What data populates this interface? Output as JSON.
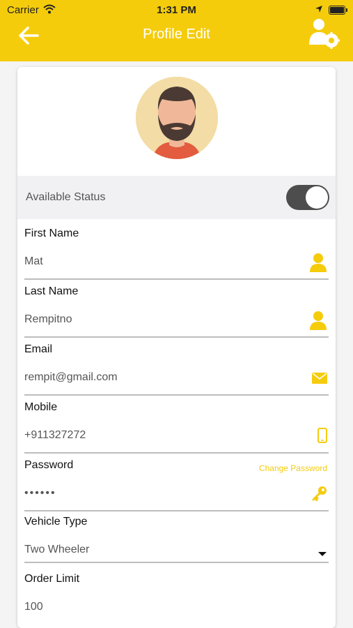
{
  "status_bar": {
    "carrier": "Carrier",
    "time": "1:31 PM"
  },
  "header": {
    "title": "Profile Edit"
  },
  "availability": {
    "label": "Available Status",
    "enabled": true
  },
  "fields": {
    "first_name": {
      "label": "First Name",
      "value": "Mat"
    },
    "last_name": {
      "label": "Last Name",
      "value": "Rempitno"
    },
    "email": {
      "label": "Email",
      "value": "rempit@gmail.com"
    },
    "mobile": {
      "label": "Mobile",
      "value": "+911327272"
    },
    "password": {
      "label": "Password",
      "value": "••••••",
      "change_link": "Change Password"
    },
    "vehicle_type": {
      "label": "Vehicle Type",
      "value": "Two Wheeler"
    },
    "order_limit": {
      "label": "Order Limit",
      "value": "100"
    }
  },
  "colors": {
    "accent": "#f5cc0c",
    "toggle_track": "#4d4d4d",
    "status_row_bg": "#f1f1f3"
  }
}
